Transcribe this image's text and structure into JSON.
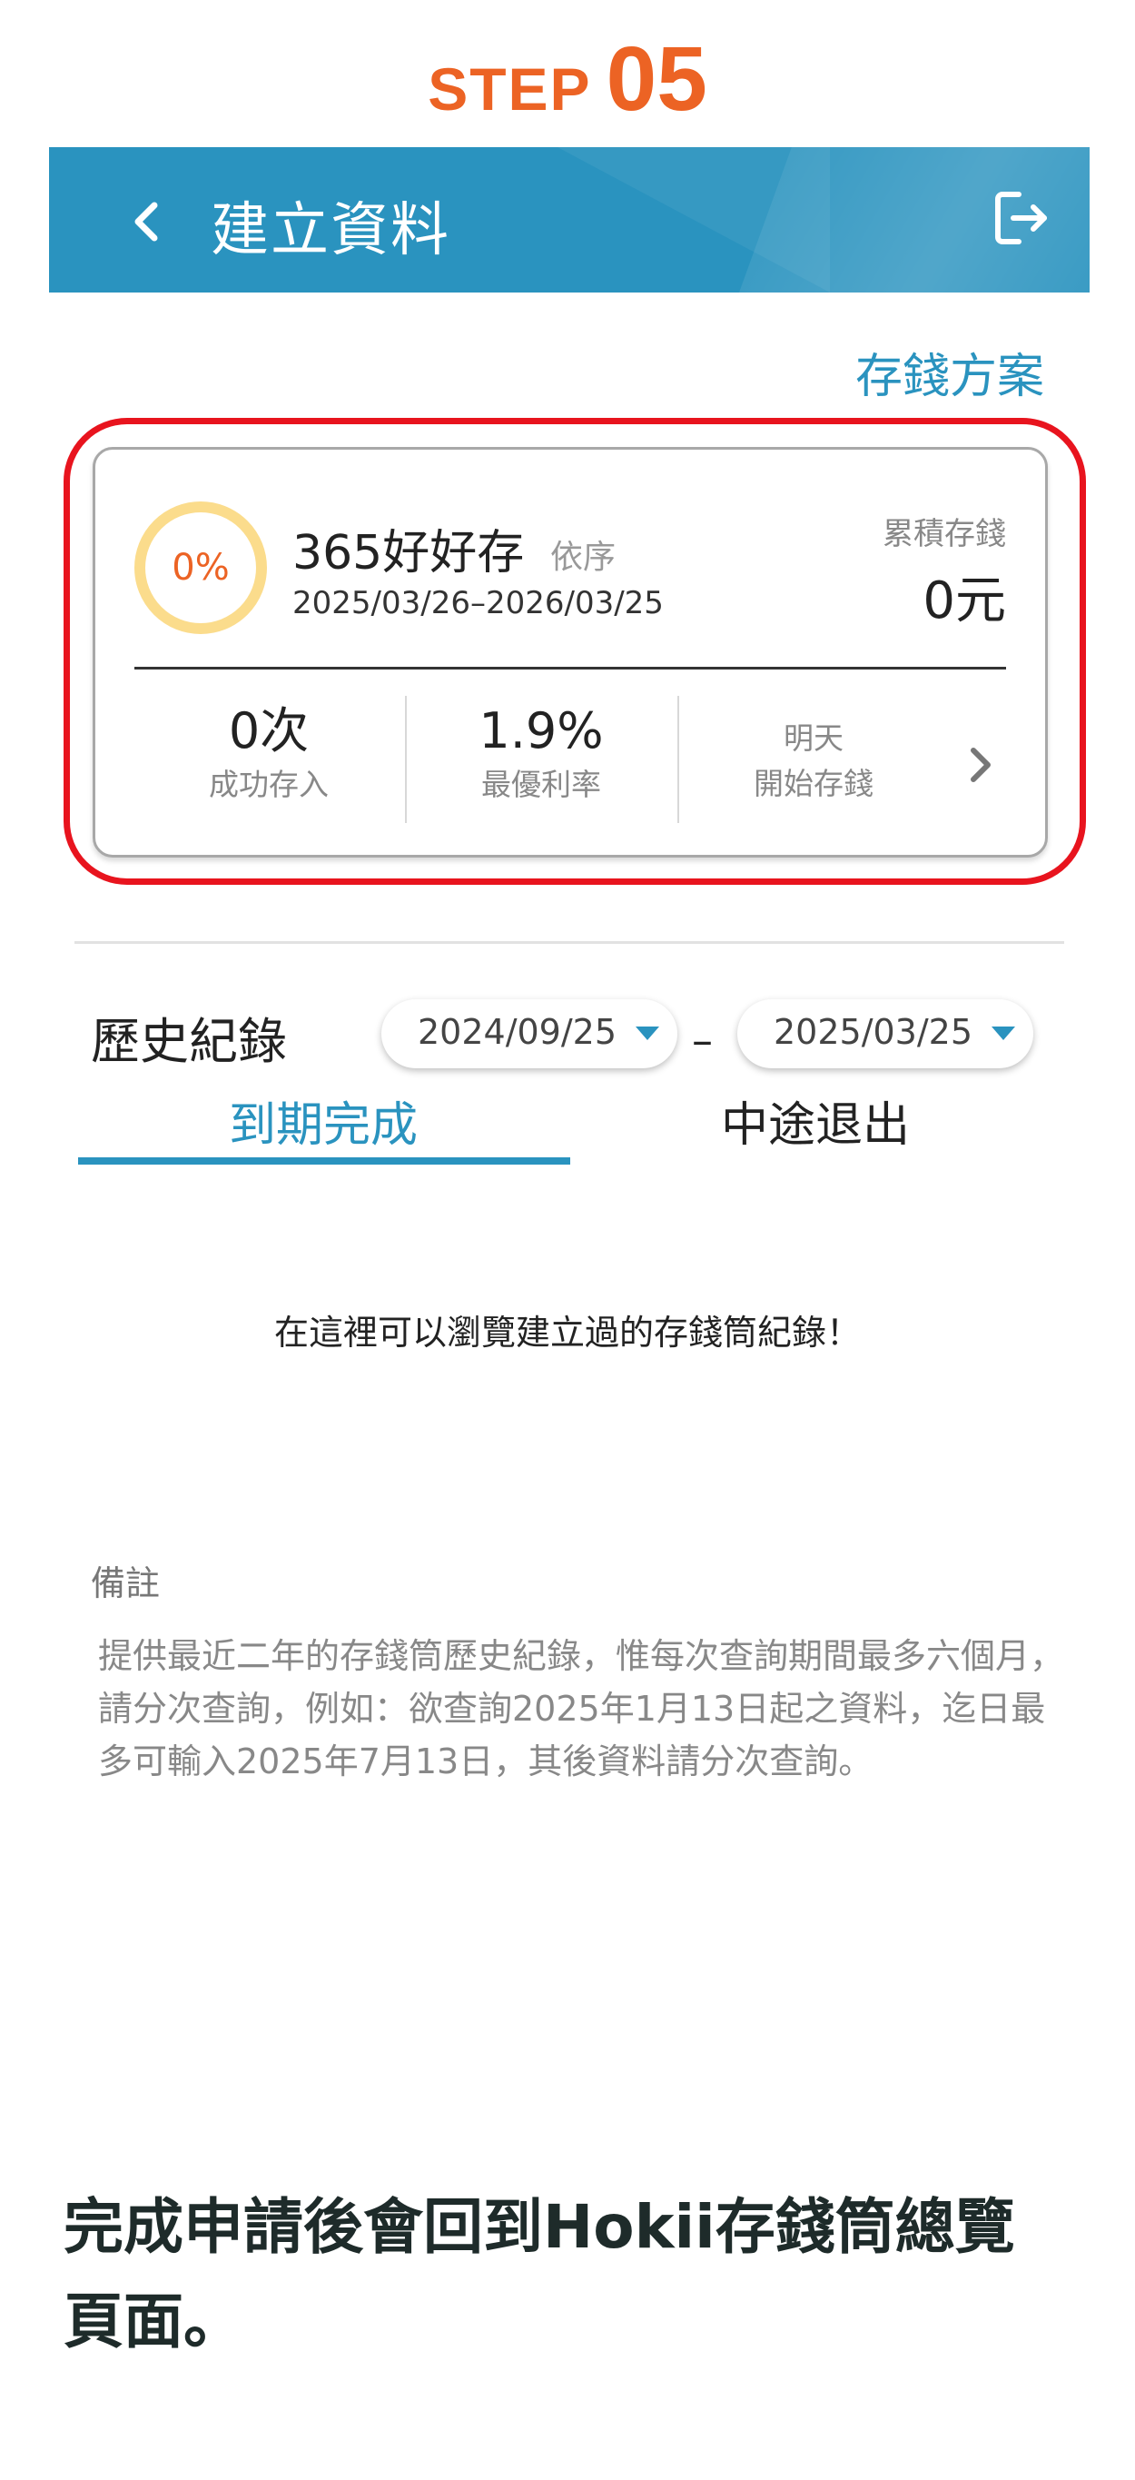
{
  "step": {
    "word": "STEP",
    "number": "05"
  },
  "header": {
    "title": "建立資料",
    "back_icon": "chevron-left-icon",
    "logout_icon": "logout-icon"
  },
  "plan_link": "存錢方案",
  "card": {
    "progress_text": "0%",
    "progress_value": 0,
    "name": "365好好存",
    "order": "依序",
    "dates": "2025/03/26–2026/03/25",
    "accum_label": "累積存錢",
    "accum_value": "0元",
    "stats": [
      {
        "value": "0次",
        "label": "成功存入"
      },
      {
        "value": "1.9%",
        "label": "最優利率"
      }
    ],
    "start_line1": "明天",
    "start_line2": "開始存錢"
  },
  "history": {
    "label": "歷史紀錄",
    "start_date": "2024/09/25",
    "separator": "–",
    "end_date": "2025/03/25"
  },
  "tabs": [
    {
      "label": "到期完成",
      "active": true
    },
    {
      "label": "中途退出",
      "active": false
    }
  ],
  "empty_message": "在這裡可以瀏覽建立過的存錢筒紀錄！",
  "note": {
    "title": "備註",
    "body": "提供最近二年的存錢筒歷史紀錄，惟每次查詢期間最多六個月，請分次查詢，例如：欲查詢2025年1月13日起之資料，迄日最多可輸入2025年7月13日，其後資料請分次查詢。"
  },
  "caption": "完成申請後會回到Hokii存錢筒總覽頁面。",
  "colors": {
    "accent": "#2a93bf",
    "step_orange": "#ec6324",
    "highlight_red": "#e8141e",
    "ring_yellow": "#fbdc8c"
  }
}
